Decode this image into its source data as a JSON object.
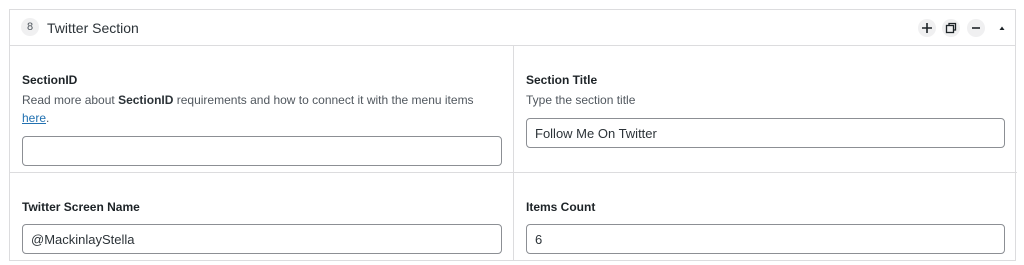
{
  "section": {
    "index": "8",
    "title": "Twitter Section",
    "icons": [
      "add-icon",
      "clone-icon",
      "remove-icon",
      "collapse-arrow-icon"
    ]
  },
  "fields": {
    "section_id": {
      "label": "SectionID",
      "desc_before": "Read more about ",
      "desc_bold": "SectionID",
      "desc_after": " requirements and how to connect it with the menu items",
      "desc_link": "here",
      "desc_end": ".",
      "value": ""
    },
    "section_title": {
      "label": "Section Title",
      "desc": "Type the section title",
      "value": "Follow Me On Twitter"
    },
    "screen_name": {
      "label": "Twitter Screen Name",
      "value": "@MackinlayStella"
    },
    "items_count": {
      "label": "Items Count",
      "value": "6"
    }
  }
}
